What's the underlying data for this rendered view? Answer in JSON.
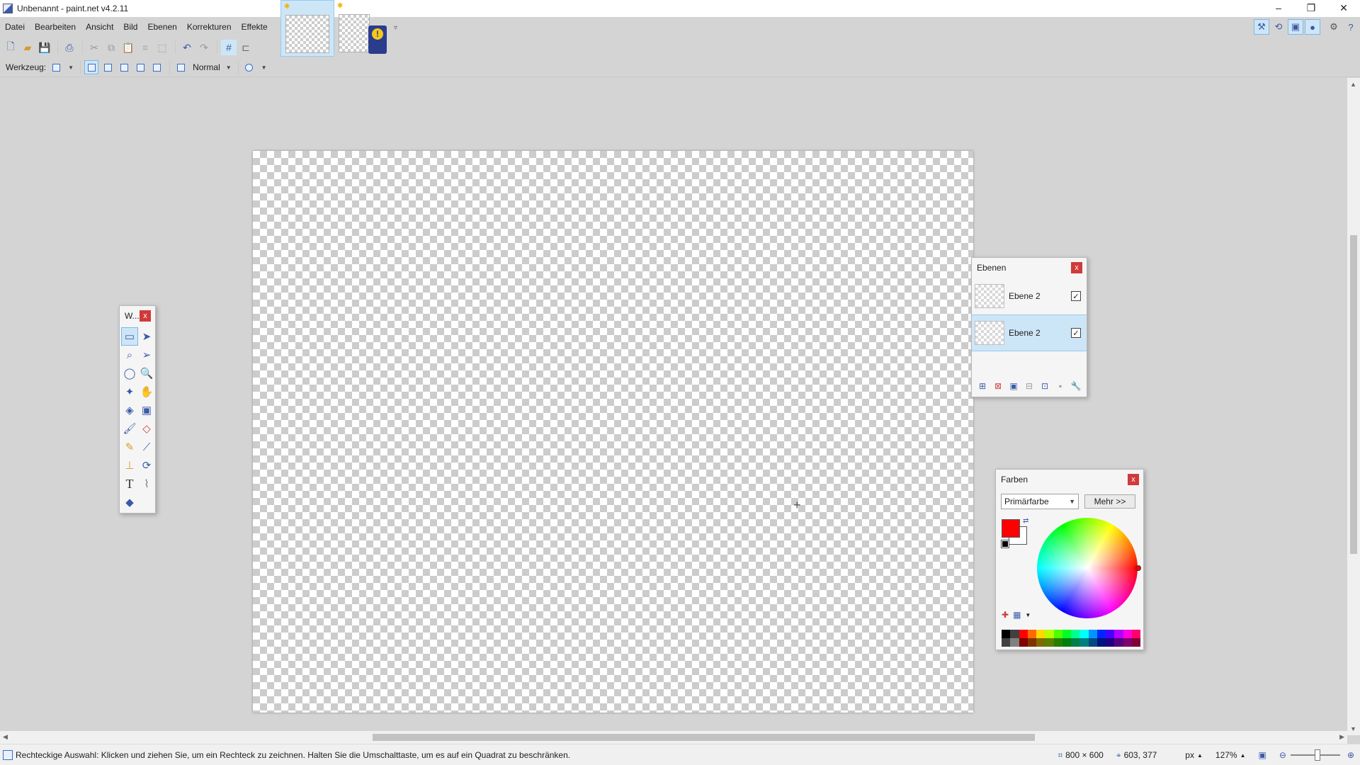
{
  "window": {
    "title": "Unbenannt - paint.net v4.2.11",
    "controls": [
      "–",
      "❐",
      "✕"
    ]
  },
  "menu": [
    "Datei",
    "Bearbeiten",
    "Ansicht",
    "Bild",
    "Ebenen",
    "Korrekturen",
    "Effekte"
  ],
  "toolbar": {
    "tool_label": "Werkzeug:",
    "blend_mode": "Normal"
  },
  "tools_panel": {
    "title": "W...",
    "close": "x"
  },
  "layers_panel": {
    "title": "Ebenen",
    "close": "x",
    "layers": [
      {
        "name": "Ebene 2",
        "visible": true,
        "selected": false
      },
      {
        "name": "Ebene 2",
        "visible": true,
        "selected": true
      }
    ]
  },
  "colors_panel": {
    "title": "Farben",
    "close": "x",
    "mode_select": "Primärfarbe",
    "more_button": "Mehr >>",
    "primary_color": "#ff0000",
    "secondary_color": "#ffffff"
  },
  "status": {
    "hint": "Rechteckige Auswahl: Klicken und ziehen Sie, um ein Rechteck zu zeichnen. Halten Sie die Umschalttaste, um es auf ein Quadrat zu beschränken.",
    "image_size": "800 × 600",
    "cursor_pos": "603, 377",
    "unit": "px",
    "zoom": "127%"
  },
  "colors": {
    "accent": "#3b5aa8",
    "selection_bg": "#cde6f7",
    "close_red": "#d03a3a"
  }
}
